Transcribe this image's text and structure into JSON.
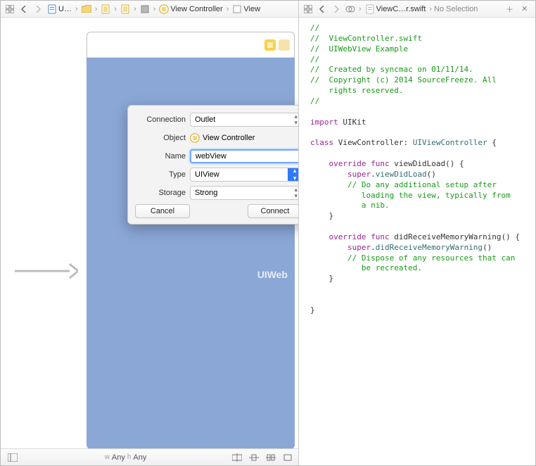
{
  "left": {
    "breadcrumb": {
      "items": [
        {
          "label": "U…"
        },
        {
          "label": ""
        },
        {
          "label": ""
        },
        {
          "label": ""
        },
        {
          "label": ""
        },
        {
          "label": "View Controller"
        },
        {
          "label": "View"
        }
      ]
    },
    "bottom": {
      "w_prefix": "w",
      "w_val": "Any",
      "h_prefix": "h",
      "h_val": "Any"
    },
    "webview_label": "UIWeb"
  },
  "popover": {
    "labels": {
      "connection": "Connection",
      "object": "Object",
      "name": "Name",
      "type": "Type",
      "storage": "Storage"
    },
    "values": {
      "connection": "Outlet",
      "object": "View Controller",
      "name": "webView",
      "type": "UIView",
      "storage": "Strong"
    },
    "buttons": {
      "cancel": "Cancel",
      "connect": "Connect"
    }
  },
  "right": {
    "breadcrumb": {
      "file": "ViewC…r.swift",
      "selection": "No Selection"
    },
    "code": {
      "c1": "//",
      "c2": "//  ViewController.swift",
      "c3": "//  UIWebView Example",
      "c4": "//",
      "c5": "//  Created by syncmac on 01/11/14.",
      "c6": "//  Copyright (c) 2014 SourceFreeze. All",
      "c6b": "    rights reserved.",
      "c7": "//",
      "imp_kw": "import",
      "imp_mod": "UIKit",
      "class_kw": "class",
      "class_name": "ViewController",
      "super_name": "UIViewController",
      "ov_kw": "override",
      "func_kw": "func",
      "vdl": "viewDidLoad",
      "super_kw": "super",
      "vdl_call": "viewDidLoad",
      "cm_vdl1": "// Do any additional setup after",
      "cm_vdl2": "   loading the view, typically from",
      "cm_vdl3": "   a nib.",
      "drmw": "didReceiveMemoryWarning",
      "drmw_call": "didReceiveMemoryWarning",
      "cm_d1": "// Dispose of any resources that can",
      "cm_d2": "   be recreated."
    }
  }
}
